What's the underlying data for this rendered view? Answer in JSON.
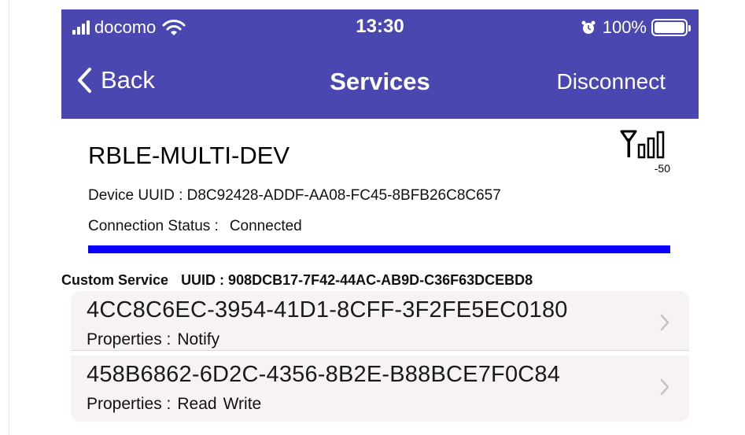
{
  "status_bar": {
    "carrier": "docomo",
    "time": "13:30",
    "battery": "100%",
    "battery_level": 1.0
  },
  "nav": {
    "back_label": "Back",
    "title": "Services",
    "disconnect_label": "Disconnect"
  },
  "device": {
    "name": "RBLE-MULTI-DEV",
    "rssi": "-50",
    "uuid_label": "Device UUID : D8C92428-ADDF-AA08-FC45-8BFB26C8C657",
    "status_label": "Connection Status :",
    "status_value": "Connected",
    "progress": 1.0
  },
  "service": {
    "name": "Custom Service",
    "uuid": "UUID : 908DCB17-7F42-44AC-AB9D-C36F63DCEBD8"
  },
  "characteristics": [
    {
      "uuid": "4CC8C6EC-3954-41D1-8CFF-3F2FE5EC0180",
      "properties_label": "Properties :",
      "properties": [
        "Notify"
      ]
    },
    {
      "uuid": "458B6862-6D2C-4356-8B2E-B88BCE7F0C84",
      "properties_label": "Properties :",
      "properties": [
        "Read",
        "Write"
      ]
    }
  ],
  "colors": {
    "nav_background": "#4a47b0",
    "progress_bar": "#0a00ff",
    "cell_background": "#f7f3f5"
  },
  "icons": {
    "signal": "cellular-signal-icon",
    "wifi": "wifi-icon",
    "alarm": "alarm-icon",
    "battery": "battery-icon",
    "back": "chevron-left-icon",
    "rssi": "antenna-signal-icon",
    "disclosure": "chevron-right-icon"
  }
}
